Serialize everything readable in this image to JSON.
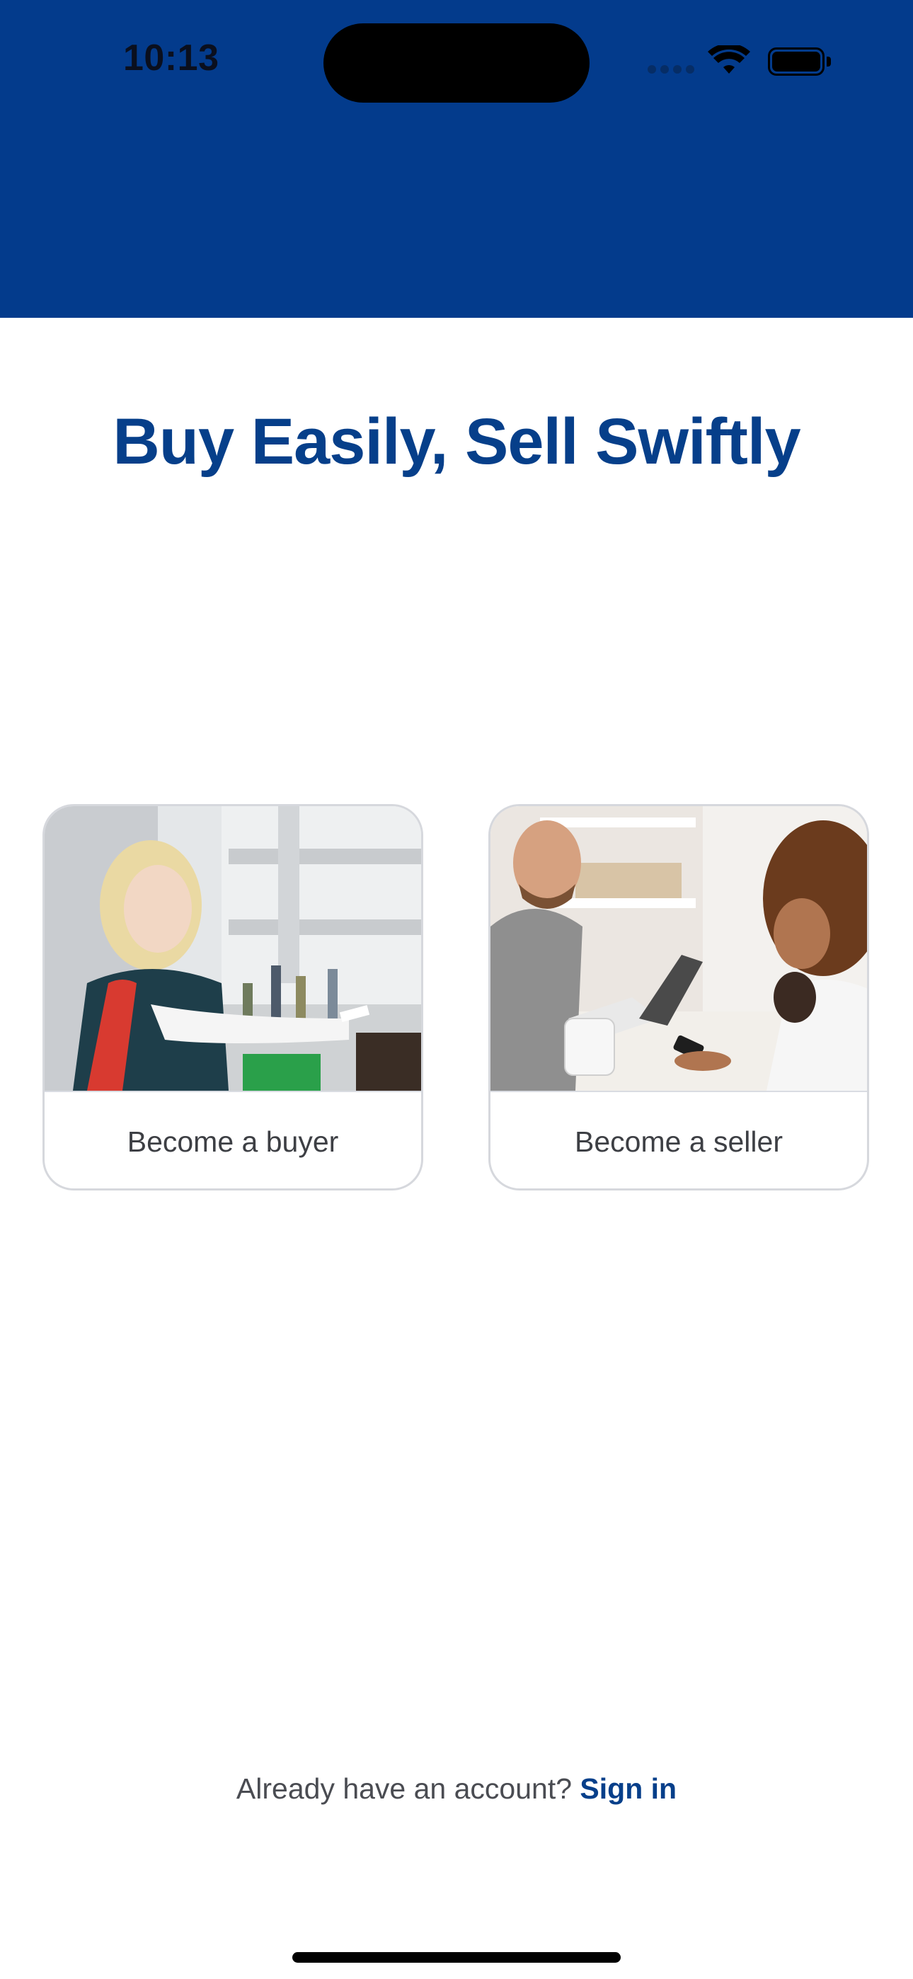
{
  "status_bar": {
    "time": "10:13",
    "icons": [
      "cellular-signal-icon",
      "wifi-icon",
      "battery-icon"
    ]
  },
  "colors": {
    "header_bg": "#033b8c",
    "brand_blue": "#063f8a",
    "card_border": "#d6d8dd",
    "text_gray": "#3d3f44"
  },
  "hero": {
    "title": "Buy Easily, Sell Swiftly"
  },
  "cards": [
    {
      "id": "buyer",
      "label": "Become a buyer",
      "image": "photo of a blonde woman shopping, handing over a card at a store counter"
    },
    {
      "id": "seller",
      "label": "Become a seller",
      "image": "photo of a smiling bearded seller at a point-of-sale terminal with a customer paying by phone"
    }
  ],
  "footer": {
    "prompt": "Already have an account?",
    "signin_label": "Sign in"
  }
}
